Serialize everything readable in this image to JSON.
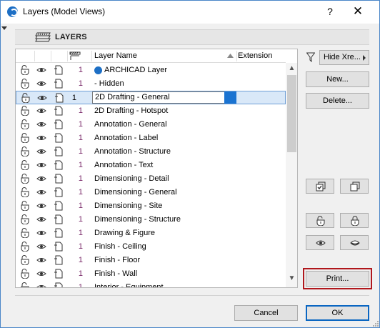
{
  "window": {
    "title": "Layers (Model Views)",
    "help_label": "?",
    "close_label": "✕"
  },
  "header": {
    "label": "LAYERS",
    "icon": "layers-stack-icon"
  },
  "list": {
    "columns": {
      "lock": "lock-icon",
      "visibility": "eye-icon",
      "wireframe": "wireframe-icon",
      "intersection": "intersection-group-icon",
      "name": "Layer Name",
      "extension": "Extension"
    },
    "rows": [
      {
        "num": "1",
        "name": "ARCHICAD Layer",
        "special_icon": true
      },
      {
        "num": "1",
        "name": "- Hidden",
        "hidden": true
      },
      {
        "num": "1",
        "name": "2D Drafting - General",
        "selected": true
      },
      {
        "num": "1",
        "name": "2D Drafting - Hotspot"
      },
      {
        "num": "1",
        "name": "Annotation - General"
      },
      {
        "num": "1",
        "name": "Annotation - Label"
      },
      {
        "num": "1",
        "name": "Annotation - Structure"
      },
      {
        "num": "1",
        "name": "Annotation - Text"
      },
      {
        "num": "1",
        "name": "Dimensioning - Detail"
      },
      {
        "num": "1",
        "name": "Dimensioning - General"
      },
      {
        "num": "1",
        "name": "Dimensioning - Site"
      },
      {
        "num": "1",
        "name": "Dimensioning - Structure"
      },
      {
        "num": "1",
        "name": "Drawing & Figure"
      },
      {
        "num": "1",
        "name": "Finish - Ceiling"
      },
      {
        "num": "1",
        "name": "Finish - Floor"
      },
      {
        "num": "1",
        "name": "Finish - Wall"
      },
      {
        "num": "1",
        "name": "Interior - Equipment"
      }
    ]
  },
  "side": {
    "filter_icon": "filter-icon",
    "hide_xref_label": "Hide Xre...",
    "new_label": "New...",
    "delete_label": "Delete...",
    "print_label": "Print..."
  },
  "footer": {
    "cancel_label": "Cancel",
    "ok_label": "OK"
  },
  "colors": {
    "selection_blue": "#1a73d1",
    "print_outline": "#b0171c",
    "number_color": "#7a2a6a"
  }
}
